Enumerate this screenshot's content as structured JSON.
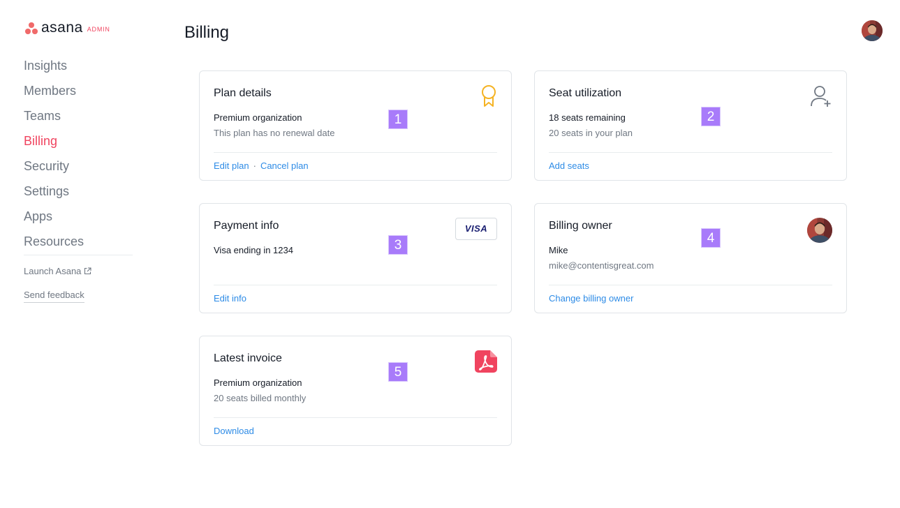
{
  "app": {
    "logo_text": "asana",
    "logo_badge": "ADMIN",
    "brand_color": "#f06a6a"
  },
  "sidebar": {
    "items": [
      {
        "label": "Insights"
      },
      {
        "label": "Members"
      },
      {
        "label": "Teams"
      },
      {
        "label": "Billing",
        "active": true
      },
      {
        "label": "Security"
      },
      {
        "label": "Settings"
      },
      {
        "label": "Apps"
      },
      {
        "label": "Resources"
      }
    ],
    "launch_label": "Launch Asana",
    "feedback_label": "Send feedback"
  },
  "header": {
    "title": "Billing",
    "avatar_icon": "user-avatar"
  },
  "cards": {
    "plan": {
      "title": "Plan details",
      "primary": "Premium organization",
      "secondary": "This plan has no renewal date",
      "action_edit": "Edit plan",
      "separator": "·",
      "action_cancel": "Cancel plan",
      "icon": "award-ribbon-icon",
      "badge": "1"
    },
    "seats": {
      "title": "Seat utilization",
      "primary": "18 seats remaining",
      "secondary": "20 seats in your plan",
      "action": "Add seats",
      "icon": "add-user-icon",
      "badge": "2"
    },
    "payment": {
      "title": "Payment info",
      "primary": "Visa ending in 1234",
      "action": "Edit info",
      "card_brand": "VISA",
      "badge": "3"
    },
    "owner": {
      "title": "Billing owner",
      "primary": "Mike",
      "secondary": "mike@contentisgreat.com",
      "action": "Change billing owner",
      "icon": "user-avatar",
      "badge": "4"
    },
    "invoice": {
      "title": "Latest invoice",
      "primary": "Premium organization",
      "secondary": "20 seats billed monthly",
      "action": "Download",
      "icon": "pdf-icon",
      "badge": "5"
    }
  },
  "colors": {
    "accent": "#f0445f",
    "link": "#2d8be6",
    "badge": "#a87bfa",
    "award": "#f5b324",
    "pdf": "#f0445f"
  }
}
